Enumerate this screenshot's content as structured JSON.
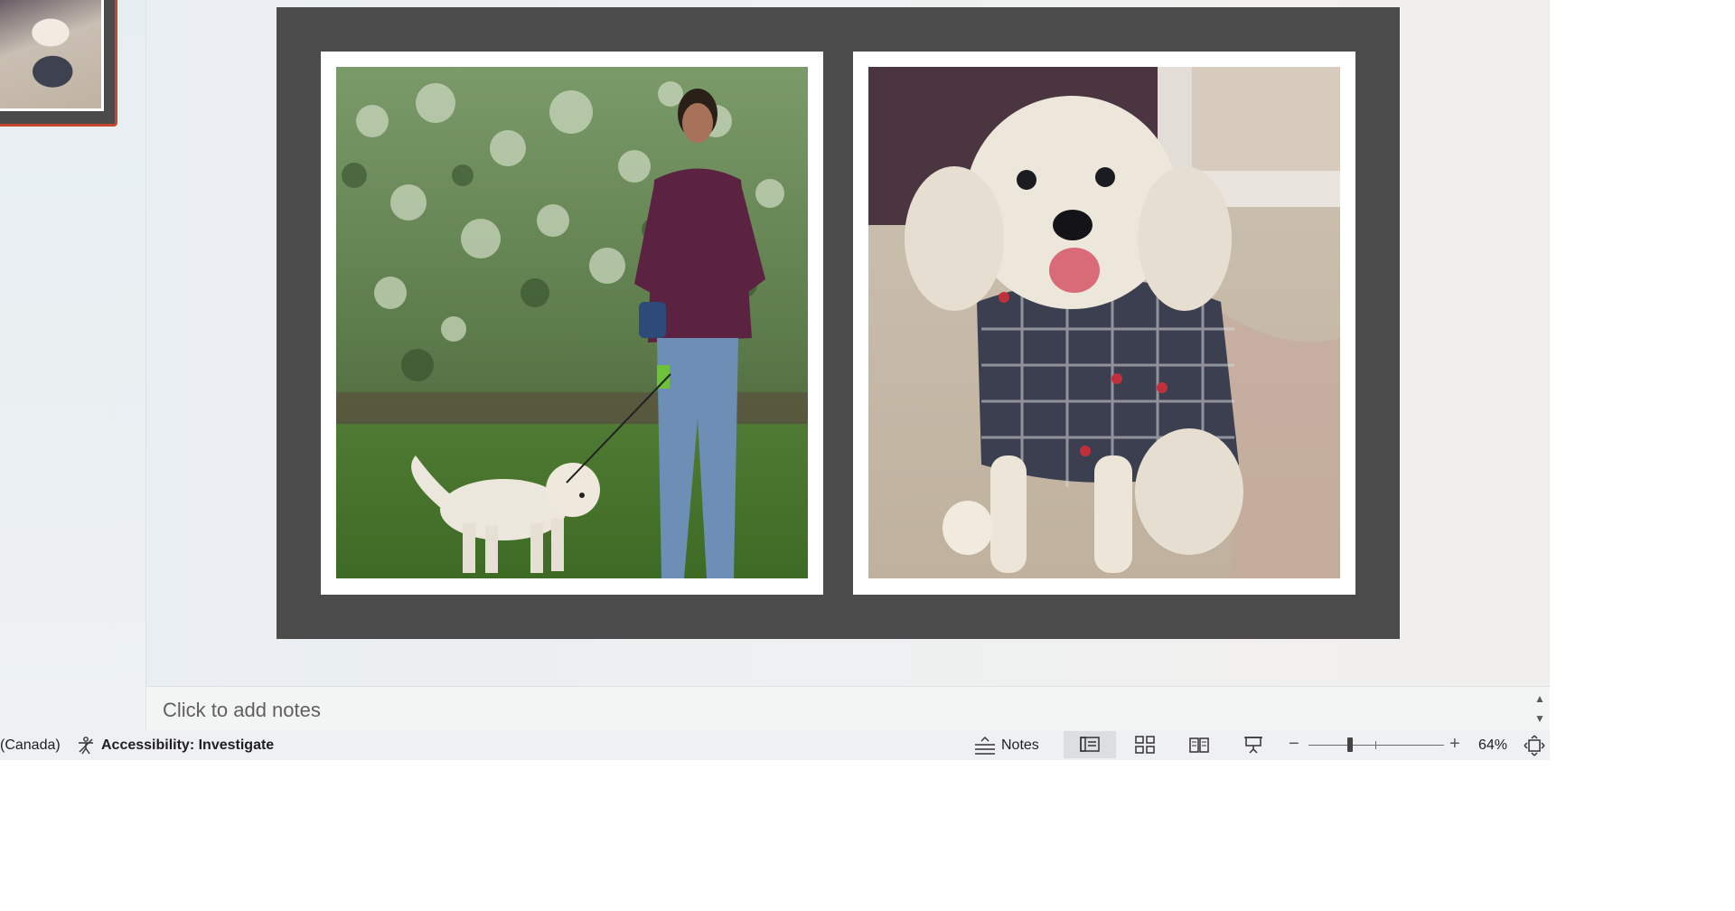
{
  "status_bar": {
    "language": "(Canada)",
    "accessibility": "Accessibility: Investigate",
    "notes_label": "Notes",
    "zoom_level": "64%",
    "zoom_out_glyph": "−",
    "zoom_in_glyph": "+",
    "views": [
      "normal-view-icon",
      "slide-sorter-icon",
      "reading-view-icon",
      "slide-show-icon"
    ]
  },
  "notes": {
    "placeholder": "Click to add notes"
  },
  "slide": {
    "background_color": "#4b4b4b",
    "photos": [
      {
        "name": "woman-with-dog-photo"
      },
      {
        "name": "dog-in-shirt-photo"
      }
    ]
  },
  "theme": {
    "selection_border": "#c4472b"
  }
}
